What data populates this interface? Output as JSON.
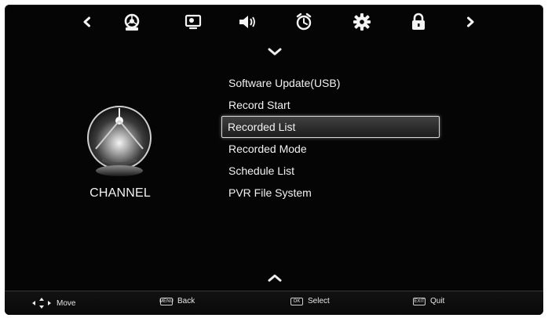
{
  "top_nav": {
    "icons": [
      {
        "name": "nav-left-arrow-icon"
      },
      {
        "name": "channel-icon"
      },
      {
        "name": "picture-icon"
      },
      {
        "name": "sound-icon"
      },
      {
        "name": "time-icon"
      },
      {
        "name": "setup-icon"
      },
      {
        "name": "lock-icon"
      },
      {
        "name": "nav-right-arrow-icon"
      }
    ]
  },
  "category": {
    "label": "CHANNEL",
    "icon": "channel-icon"
  },
  "menu": {
    "items": [
      {
        "label": "Software Update(USB)",
        "selected": false
      },
      {
        "label": "Record Start",
        "selected": false
      },
      {
        "label": "Recorded List",
        "selected": true
      },
      {
        "label": "Recorded Mode",
        "selected": false
      },
      {
        "label": "Schedule List",
        "selected": false
      },
      {
        "label": "PVR File System",
        "selected": false
      }
    ]
  },
  "footer": {
    "move_label": "Move",
    "back_label": "Back",
    "back_key": "MENU",
    "select_label": "Select",
    "select_key": "OK",
    "quit_label": "Quit",
    "quit_key": "EXIT"
  },
  "colors": {
    "background": "#050505",
    "text": "#f2f2f2",
    "highlight_border": "#d8d8d8"
  }
}
